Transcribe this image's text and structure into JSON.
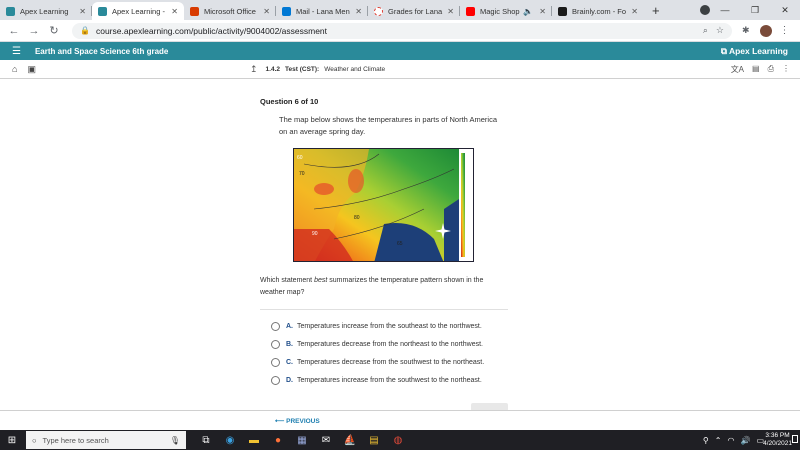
{
  "browser": {
    "tabs": [
      {
        "label": "Apex Learning",
        "color": "#2a8a9a",
        "active": false
      },
      {
        "label": "Apex Learning -",
        "color": "#2a8a9a",
        "active": true
      },
      {
        "label": "Microsoft Office",
        "color": "#d83b01",
        "active": false
      },
      {
        "label": "Mail - Lana Men",
        "color": "#0078d4",
        "active": false
      },
      {
        "label": "Grades for Lana",
        "color": "#e03c31",
        "active": false
      },
      {
        "label": "Magic Shop",
        "color": "#ff0000",
        "active": false
      },
      {
        "label": "Brainly.com - Fo",
        "color": "#1a1a1a",
        "active": false
      }
    ],
    "url": "course.apexlearning.com/public/activity/9004002/assessment"
  },
  "apex": {
    "course_title": "Earth and Space Science 6th grade",
    "brand": "Apex Learning",
    "breadcrumb": {
      "number": "1.4.2",
      "type": "Test (CST):",
      "topic": "Weather and Climate"
    }
  },
  "question": {
    "header": "Question 6 of 10",
    "text": "The map below shows the temperatures in parts of North America on an average spring day.",
    "stem_before": "Which statement ",
    "stem_em": "best",
    "stem_after": " summarizes the temperature pattern shown in the weather map?",
    "map_labels": [
      "60",
      "70",
      "80",
      "90",
      "65"
    ],
    "options": [
      {
        "letter": "A.",
        "text": "Temperatures increase from the southeast to the northwest."
      },
      {
        "letter": "B.",
        "text": "Temperatures decrease from the northeast to the northwest."
      },
      {
        "letter": "C.",
        "text": "Temperatures decrease from the southwest to the northeast."
      },
      {
        "letter": "D.",
        "text": "Temperatures increase from the southwest to the northeast."
      }
    ]
  },
  "footer": {
    "previous": "PREVIOUS"
  },
  "taskbar": {
    "search_placeholder": "Type here to search",
    "time": "3:36 PM",
    "date": "4/20/2021"
  }
}
